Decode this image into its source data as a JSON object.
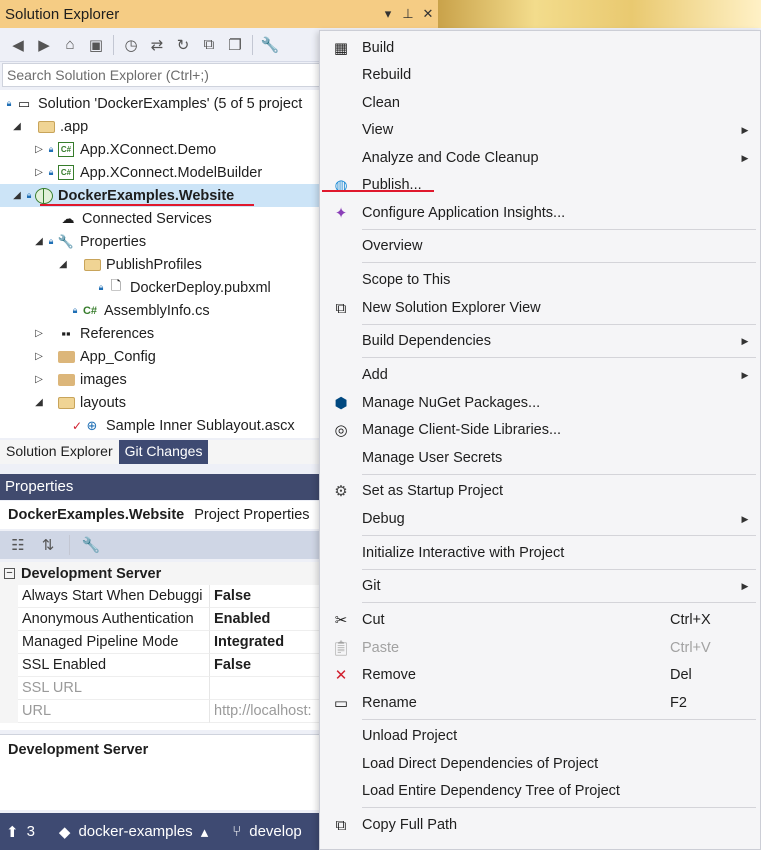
{
  "solution_explorer": {
    "title": "Solution Explorer",
    "title_buttons": [
      "▾",
      "⊥",
      "✕"
    ],
    "search_placeholder": "Search Solution Explorer (Ctrl+;)",
    "tree": [
      {
        "label": "Solution 'DockerExamples' (5 of 5 project",
        "icon": "solution-icon"
      },
      {
        "label": ".app",
        "icon": "folder-icon"
      },
      {
        "label": "App.XConnect.Demo",
        "icon": "csharp-project-icon"
      },
      {
        "label": "App.XConnect.ModelBuilder",
        "icon": "csharp-project-icon"
      },
      {
        "label": "DockerExamples.Website",
        "icon": "web-project-icon"
      },
      {
        "label": "Connected Services",
        "icon": "connected-services-icon"
      },
      {
        "label": "Properties",
        "icon": "wrench-icon"
      },
      {
        "label": "PublishProfiles",
        "icon": "folder-icon"
      },
      {
        "label": "DockerDeploy.pubxml",
        "icon": "file-icon"
      },
      {
        "label": "AssemblyInfo.cs",
        "icon": "csharp-file-icon"
      },
      {
        "label": "References",
        "icon": "references-icon"
      },
      {
        "label": "App_Config",
        "icon": "folder-icon"
      },
      {
        "label": "images",
        "icon": "folder-icon"
      },
      {
        "label": "layouts",
        "icon": "folder-icon"
      },
      {
        "label": "Sample Inner Sublayout.ascx",
        "icon": "ascx-file-icon"
      }
    ],
    "tabs": {
      "solution_explorer": "Solution Explorer",
      "git_changes": "Git Changes"
    }
  },
  "properties": {
    "title": "Properties",
    "object_name": "DockerExamples.Website",
    "object_type": "Project Properties",
    "category": "Development Server",
    "rows": [
      {
        "name": "Always Start When Debuggi",
        "value": "False"
      },
      {
        "name": "Anonymous Authentication",
        "value": "Enabled"
      },
      {
        "name": "Managed Pipeline Mode",
        "value": "Integrated"
      },
      {
        "name": "SSL Enabled",
        "value": "False"
      },
      {
        "name": "SSL URL",
        "value": ""
      },
      {
        "name": "URL",
        "value": "http://localhost:"
      }
    ],
    "description_title": "Development Server"
  },
  "statusbar": {
    "count": "3",
    "branch": "docker-examples",
    "repo": "develop"
  },
  "context_menu": {
    "build": "Build",
    "rebuild": "Rebuild",
    "clean": "Clean",
    "view": "View",
    "analyze": "Analyze and Code Cleanup",
    "publish": "Publish...",
    "configure_insights": "Configure Application Insights...",
    "overview": "Overview",
    "scope": "Scope to This",
    "new_se_view": "New Solution Explorer View",
    "build_deps": "Build Dependencies",
    "add": "Add",
    "manage_nuget": "Manage NuGet Packages...",
    "manage_client_libs": "Manage Client-Side Libraries...",
    "manage_secrets": "Manage User Secrets",
    "startup": "Set as Startup Project",
    "debug": "Debug",
    "init_interactive": "Initialize Interactive with Project",
    "git": "Git",
    "cut": "Cut",
    "cut_shortcut": "Ctrl+X",
    "paste": "Paste",
    "paste_shortcut": "Ctrl+V",
    "remove": "Remove",
    "remove_shortcut": "Del",
    "rename": "Rename",
    "rename_shortcut": "F2",
    "unload": "Unload Project",
    "load_direct": "Load Direct Dependencies of Project",
    "load_tree": "Load Entire Dependency Tree of Project",
    "copy_path": "Copy Full Path"
  },
  "colors": {
    "title_accent": "#f5cc84",
    "panel_header": "#404a6e",
    "statusbar": "#3e4a72",
    "selection": "#cce4f7",
    "annotation_red": "#e0182d"
  }
}
